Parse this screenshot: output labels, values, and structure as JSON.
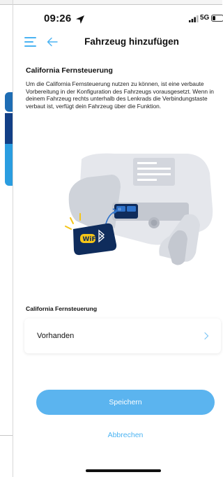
{
  "status_bar": {
    "time": "09:26",
    "network": "5G"
  },
  "nav": {
    "title": "Fahrzeug hinzufügen",
    "icons": [
      "menu-icon",
      "back-arrow-icon"
    ]
  },
  "content": {
    "section_title": "California Fernsteuerung",
    "description": "Um die California Fernsteuerung nutzen zu können, ist eine verbaute Vorbereitung in der Konfiguration des Fahrzeugs vorausgesetzt. Wenn in deinem Fahrzeug rechts unterhalb des Lenkrads die Verbindungstaste verbaut ist, verfügt dein Fahrzeug über die Funktion.",
    "field_label": "California Fernsteuerung",
    "field_value": "Vorhanden"
  },
  "actions": {
    "save_label": "Speichern",
    "cancel_label": "Abbrechen"
  },
  "colors": {
    "accent": "#4ab3f2",
    "button": "#5bb4ef",
    "illustration_dark": "#0f2c5c",
    "illustration_yellow": "#f5c518"
  }
}
